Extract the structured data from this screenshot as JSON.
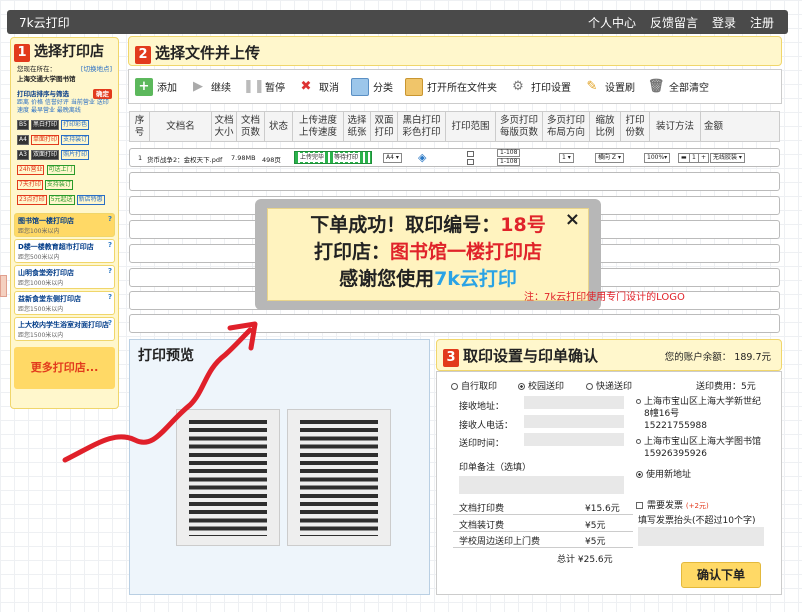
{
  "topbar": {
    "brand": "7k云打印",
    "links": [
      "个人中心",
      "反馈留言",
      "登录",
      "注册"
    ]
  },
  "step1": {
    "num": "1",
    "title": "选择打印店",
    "location_label": "您现在所在：",
    "switch_link": "[切换地点]",
    "location": "上海交通大学图书馆",
    "sort_label": "打印店排序与筛选",
    "sort_btn": "确定",
    "sort_options": [
      "距离",
      "价格",
      "信誉好评",
      "当前营业",
      "送印速度",
      "最早营业",
      "最晚离线"
    ],
    "paper_rows": [
      {
        "size": "B5",
        "tags": [
          "黑白打印",
          "打印彩色"
        ]
      },
      {
        "size": "A4",
        "tags": [
          "单面打印",
          "支持装订"
        ]
      },
      {
        "size": "A3",
        "tags": [
          "双面打印",
          "照片打印"
        ]
      }
    ],
    "extra_tags": [
      "24h营业",
      "可送上门",
      "7天打印",
      "支持装订",
      "23点打印",
      "5元起送",
      "特价",
      "新店特惠"
    ],
    "stores": [
      {
        "name": "图书馆一楼打印店",
        "dist": "距您100米以内"
      },
      {
        "name": "D楼一楼教育超市打印店",
        "dist": "距您500米以内"
      },
      {
        "name": "山明食堂旁打印店",
        "dist": "距您1000米以内"
      },
      {
        "name": "益新食堂东侧打印店",
        "dist": "距您1500米以内"
      },
      {
        "name": "上大校内学生浴室对面打印店",
        "dist": "距您1500米以内"
      }
    ],
    "more": "更多打印店..."
  },
  "step2": {
    "num": "2",
    "title": "选择文件并上传",
    "toolbar": [
      "添加",
      "继续",
      "暂停",
      "取消",
      "分类",
      "打开所在文件夹",
      "打印设置",
      "设置刷",
      "全部清空"
    ],
    "columns": [
      "序\n号",
      "文档名",
      "文档\n大小",
      "文档\n页数",
      "状态",
      "上传进度\n上传速度",
      "选择\n纸张",
      "双面\n打印",
      "黑白打印\n彩色打印",
      "打印范围",
      "多页打印\n每版页数",
      "多页打印\n布局方向",
      "缩放\n比例",
      "打印\n份数",
      "装订方法",
      "金额"
    ],
    "file": {
      "index": "1",
      "name": "货币战争2：金权天下.pdf",
      "size": "7.98MB",
      "pages": "498页",
      "status": "上传完毕",
      "speed": "等待打印",
      "paper": "A4",
      "range_from": "1-108",
      "range_to": "1-108",
      "per_sheet": "1",
      "direction": "横向",
      "scale": "100%",
      "copies": "1",
      "binding": "无线胶装"
    }
  },
  "modal": {
    "line1_prefix": "下单成功！取印编号：",
    "line1_value": "18号",
    "line2_prefix": "打印店：",
    "line2_value": "图书馆一楼打印店",
    "line3_prefix": "感谢您使用",
    "line3_value": "7k云打印",
    "note": "注：7k云打印使用专门设计的LOGO",
    "close": "×"
  },
  "preview": {
    "title": "打印预览"
  },
  "step3": {
    "num": "3",
    "title": "取印设置与印单确认",
    "balance_label": "您的账户余额：",
    "balance": "189.7元",
    "pickup": [
      "自行取印",
      "校园送印",
      "快递送印"
    ],
    "delivery_fee": "送印费用：5元",
    "fields": [
      "接收地址：",
      "接收人电话：",
      "送印时间："
    ],
    "remark_label": "印单备注（选填）",
    "addresses": [
      {
        "line1": "上海市宝山区上海大学新世纪",
        "line2": "8幢16号",
        "phone": "15221755988"
      },
      {
        "line1": "上海市宝山区上海大学图书馆",
        "phone": "15926395926"
      }
    ],
    "new_address": "使用新地址",
    "costs": [
      {
        "label": "文档打印费",
        "value": "¥15.6元"
      },
      {
        "label": "文档装订费",
        "value": "¥5元"
      },
      {
        "label": "学校周边送印上门费",
        "value": "¥5元"
      }
    ],
    "total": "总计  ¥25.6元",
    "invoice_label": "需要发票",
    "invoice_extra": "(+2元)",
    "invoice_head": "填写发票抬头(不超过10个字)",
    "confirm_btn": "确认下单"
  }
}
